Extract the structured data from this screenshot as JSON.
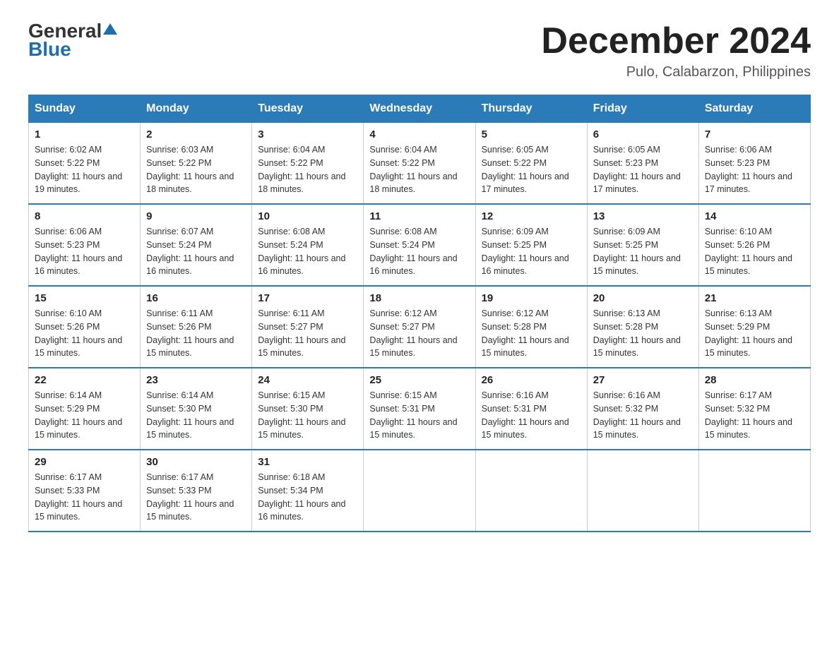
{
  "header": {
    "logo_general": "General",
    "logo_blue": "Blue",
    "title": "December 2024",
    "subtitle": "Pulo, Calabarzon, Philippines"
  },
  "days_of_week": [
    "Sunday",
    "Monday",
    "Tuesday",
    "Wednesday",
    "Thursday",
    "Friday",
    "Saturday"
  ],
  "weeks": [
    [
      {
        "day": "1",
        "sunrise": "6:02 AM",
        "sunset": "5:22 PM",
        "daylight": "11 hours and 19 minutes."
      },
      {
        "day": "2",
        "sunrise": "6:03 AM",
        "sunset": "5:22 PM",
        "daylight": "11 hours and 18 minutes."
      },
      {
        "day": "3",
        "sunrise": "6:04 AM",
        "sunset": "5:22 PM",
        "daylight": "11 hours and 18 minutes."
      },
      {
        "day": "4",
        "sunrise": "6:04 AM",
        "sunset": "5:22 PM",
        "daylight": "11 hours and 18 minutes."
      },
      {
        "day": "5",
        "sunrise": "6:05 AM",
        "sunset": "5:22 PM",
        "daylight": "11 hours and 17 minutes."
      },
      {
        "day": "6",
        "sunrise": "6:05 AM",
        "sunset": "5:23 PM",
        "daylight": "11 hours and 17 minutes."
      },
      {
        "day": "7",
        "sunrise": "6:06 AM",
        "sunset": "5:23 PM",
        "daylight": "11 hours and 17 minutes."
      }
    ],
    [
      {
        "day": "8",
        "sunrise": "6:06 AM",
        "sunset": "5:23 PM",
        "daylight": "11 hours and 16 minutes."
      },
      {
        "day": "9",
        "sunrise": "6:07 AM",
        "sunset": "5:24 PM",
        "daylight": "11 hours and 16 minutes."
      },
      {
        "day": "10",
        "sunrise": "6:08 AM",
        "sunset": "5:24 PM",
        "daylight": "11 hours and 16 minutes."
      },
      {
        "day": "11",
        "sunrise": "6:08 AM",
        "sunset": "5:24 PM",
        "daylight": "11 hours and 16 minutes."
      },
      {
        "day": "12",
        "sunrise": "6:09 AM",
        "sunset": "5:25 PM",
        "daylight": "11 hours and 16 minutes."
      },
      {
        "day": "13",
        "sunrise": "6:09 AM",
        "sunset": "5:25 PM",
        "daylight": "11 hours and 15 minutes."
      },
      {
        "day": "14",
        "sunrise": "6:10 AM",
        "sunset": "5:26 PM",
        "daylight": "11 hours and 15 minutes."
      }
    ],
    [
      {
        "day": "15",
        "sunrise": "6:10 AM",
        "sunset": "5:26 PM",
        "daylight": "11 hours and 15 minutes."
      },
      {
        "day": "16",
        "sunrise": "6:11 AM",
        "sunset": "5:26 PM",
        "daylight": "11 hours and 15 minutes."
      },
      {
        "day": "17",
        "sunrise": "6:11 AM",
        "sunset": "5:27 PM",
        "daylight": "11 hours and 15 minutes."
      },
      {
        "day": "18",
        "sunrise": "6:12 AM",
        "sunset": "5:27 PM",
        "daylight": "11 hours and 15 minutes."
      },
      {
        "day": "19",
        "sunrise": "6:12 AM",
        "sunset": "5:28 PM",
        "daylight": "11 hours and 15 minutes."
      },
      {
        "day": "20",
        "sunrise": "6:13 AM",
        "sunset": "5:28 PM",
        "daylight": "11 hours and 15 minutes."
      },
      {
        "day": "21",
        "sunrise": "6:13 AM",
        "sunset": "5:29 PM",
        "daylight": "11 hours and 15 minutes."
      }
    ],
    [
      {
        "day": "22",
        "sunrise": "6:14 AM",
        "sunset": "5:29 PM",
        "daylight": "11 hours and 15 minutes."
      },
      {
        "day": "23",
        "sunrise": "6:14 AM",
        "sunset": "5:30 PM",
        "daylight": "11 hours and 15 minutes."
      },
      {
        "day": "24",
        "sunrise": "6:15 AM",
        "sunset": "5:30 PM",
        "daylight": "11 hours and 15 minutes."
      },
      {
        "day": "25",
        "sunrise": "6:15 AM",
        "sunset": "5:31 PM",
        "daylight": "11 hours and 15 minutes."
      },
      {
        "day": "26",
        "sunrise": "6:16 AM",
        "sunset": "5:31 PM",
        "daylight": "11 hours and 15 minutes."
      },
      {
        "day": "27",
        "sunrise": "6:16 AM",
        "sunset": "5:32 PM",
        "daylight": "11 hours and 15 minutes."
      },
      {
        "day": "28",
        "sunrise": "6:17 AM",
        "sunset": "5:32 PM",
        "daylight": "11 hours and 15 minutes."
      }
    ],
    [
      {
        "day": "29",
        "sunrise": "6:17 AM",
        "sunset": "5:33 PM",
        "daylight": "11 hours and 15 minutes."
      },
      {
        "day": "30",
        "sunrise": "6:17 AM",
        "sunset": "5:33 PM",
        "daylight": "11 hours and 15 minutes."
      },
      {
        "day": "31",
        "sunrise": "6:18 AM",
        "sunset": "5:34 PM",
        "daylight": "11 hours and 16 minutes."
      },
      null,
      null,
      null,
      null
    ]
  ]
}
